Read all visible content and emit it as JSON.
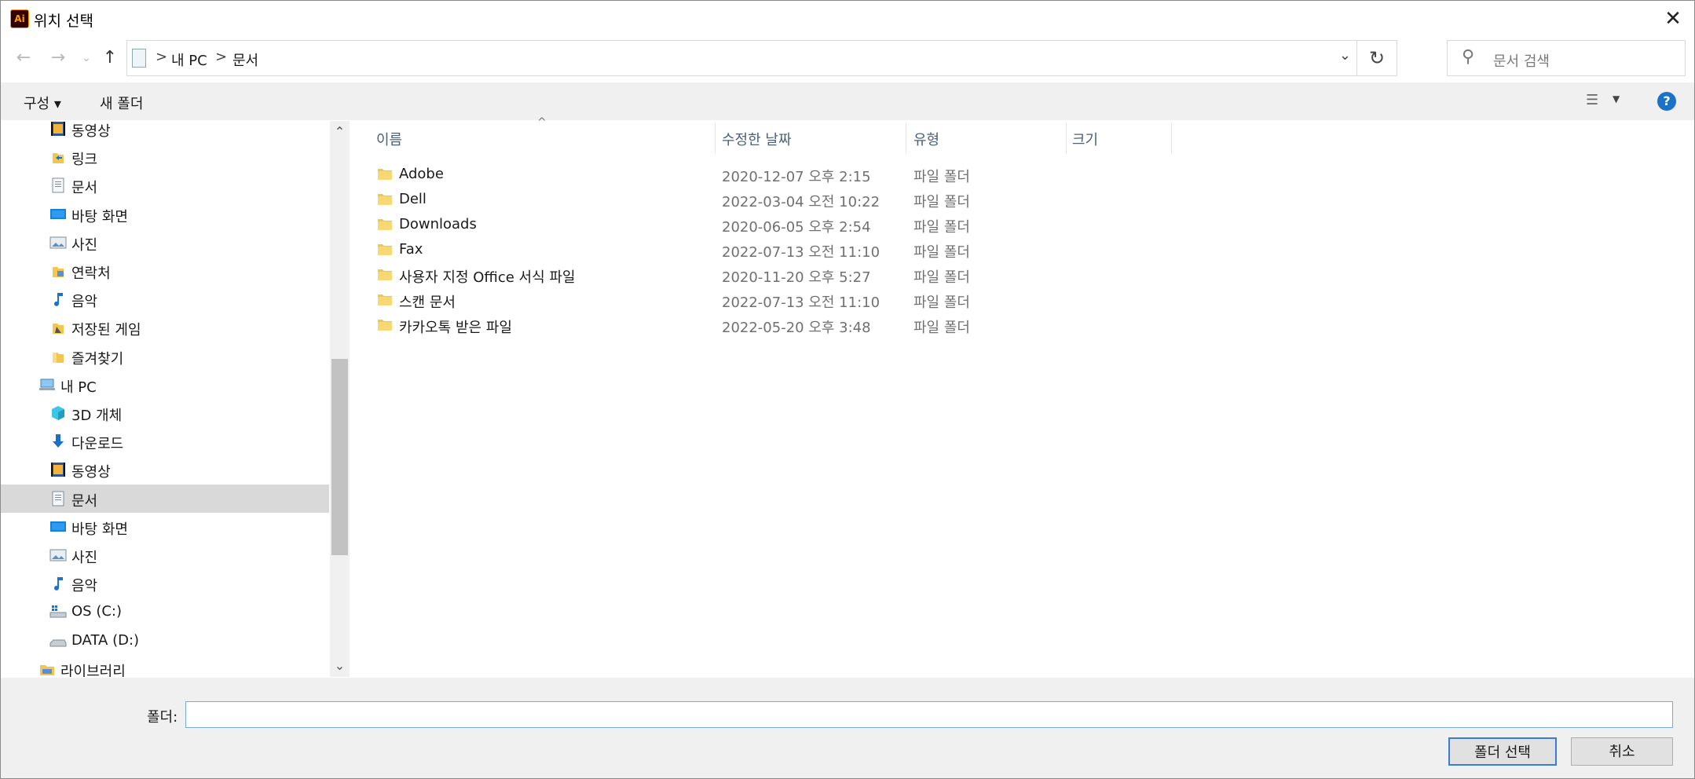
{
  "window": {
    "title": "위치 선택",
    "app_icon_text": "Ai"
  },
  "nav_buttons": {
    "back": "←",
    "forward": "→",
    "recent": "⌄",
    "up": "↑"
  },
  "address": {
    "crumbs": [
      "내 PC",
      "문서"
    ],
    "separator": ">",
    "dropdown": "⌄",
    "refresh": "↻"
  },
  "search": {
    "placeholder": "문서 검색"
  },
  "toolbar": {
    "organize": "구성 ▾",
    "new_folder": "새 폴더",
    "help": "?"
  },
  "sidebar": {
    "items": [
      {
        "label": "동영상",
        "icon": "video-icon",
        "indent": 2,
        "selected": false
      },
      {
        "label": "링크",
        "icon": "link-icon",
        "indent": 2,
        "selected": false
      },
      {
        "label": "문서",
        "icon": "document-icon",
        "indent": 2,
        "selected": false
      },
      {
        "label": "바탕 화면",
        "icon": "desktop-icon",
        "indent": 2,
        "selected": false
      },
      {
        "label": "사진",
        "icon": "picture-icon",
        "indent": 2,
        "selected": false
      },
      {
        "label": "연락처",
        "icon": "contacts-icon",
        "indent": 2,
        "selected": false
      },
      {
        "label": "음악",
        "icon": "music-icon",
        "indent": 2,
        "selected": false
      },
      {
        "label": "저장된 게임",
        "icon": "saved-games-icon",
        "indent": 2,
        "selected": false
      },
      {
        "label": "즐겨찾기",
        "icon": "favorites-icon",
        "indent": 2,
        "selected": false
      },
      {
        "label": "내 PC",
        "icon": "pc-icon",
        "indent": 1,
        "selected": false
      },
      {
        "label": "3D 개체",
        "icon": "3d-objects-icon",
        "indent": 2,
        "selected": false
      },
      {
        "label": "다운로드",
        "icon": "download-icon",
        "indent": 2,
        "selected": false
      },
      {
        "label": "동영상",
        "icon": "video-icon",
        "indent": 2,
        "selected": false
      },
      {
        "label": "문서",
        "icon": "document-icon",
        "indent": 2,
        "selected": true
      },
      {
        "label": "바탕 화면",
        "icon": "desktop-icon",
        "indent": 2,
        "selected": false
      },
      {
        "label": "사진",
        "icon": "picture-icon",
        "indent": 2,
        "selected": false
      },
      {
        "label": "음악",
        "icon": "music-icon",
        "indent": 2,
        "selected": false
      },
      {
        "label": "OS (C:)",
        "icon": "os-drive-icon",
        "indent": 2,
        "selected": false
      },
      {
        "label": "DATA (D:)",
        "icon": "drive-icon",
        "indent": 2,
        "selected": false
      },
      {
        "label": "라이브러리",
        "icon": "library-icon",
        "indent": 1,
        "selected": false
      }
    ]
  },
  "columns": {
    "name": "이름",
    "date": "수정한 날짜",
    "type": "유형",
    "size": "크기",
    "sort_arrow": "^"
  },
  "files": [
    {
      "name": "Adobe",
      "date": "2020-12-07 오후 2:15",
      "type": "파일 폴더"
    },
    {
      "name": "Dell",
      "date": "2022-03-04 오전 10:22",
      "type": "파일 폴더"
    },
    {
      "name": "Downloads",
      "date": "2020-06-05 오후 2:54",
      "type": "파일 폴더"
    },
    {
      "name": "Fax",
      "date": "2022-07-13 오전 11:10",
      "type": "파일 폴더"
    },
    {
      "name": "사용자 지정 Office 서식 파일",
      "date": "2020-11-20 오후 5:27",
      "type": "파일 폴더"
    },
    {
      "name": "스캔 문서",
      "date": "2022-07-13 오전 11:10",
      "type": "파일 폴더"
    },
    {
      "name": "카카오톡 받은 파일",
      "date": "2022-05-20 오후 3:48",
      "type": "파일 폴더"
    }
  ],
  "footer": {
    "folder_label": "폴더:",
    "folder_value": "",
    "select_button": "폴더 선택",
    "cancel_button": "취소"
  },
  "colors": {
    "accent": "#3a7bd5",
    "selection": "#d9d9d9",
    "folder": "#f3c74f",
    "help": "#1a73c9"
  }
}
